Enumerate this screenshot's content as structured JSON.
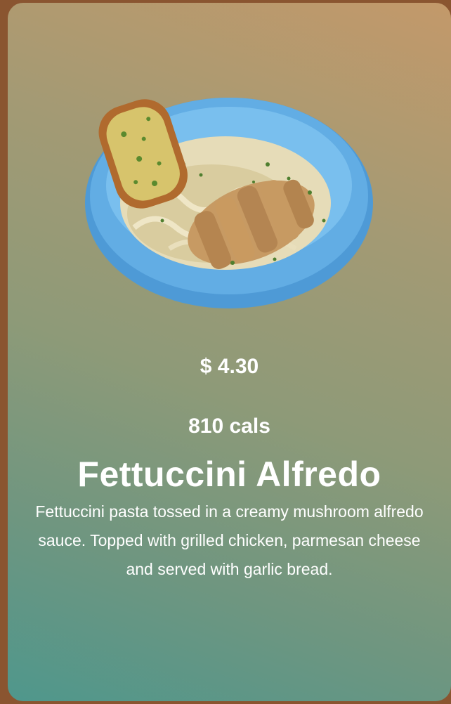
{
  "item": {
    "price": "$ 4.30",
    "calories": "810 cals",
    "name": "Fettuccini Alfredo",
    "description": "Fettuccini pasta tossed in a creamy mushroom alfredo sauce. Topped with grilled chicken, parmesan cheese and served with garlic bread.",
    "image_icon": "pasta-bowl-icon"
  },
  "colors": {
    "page_background": "#8a5530",
    "card_top_right": "#c3996a",
    "card_bottom_left": "#4f978c",
    "text": "#ffffff",
    "bowl": "#5aa8e0"
  }
}
